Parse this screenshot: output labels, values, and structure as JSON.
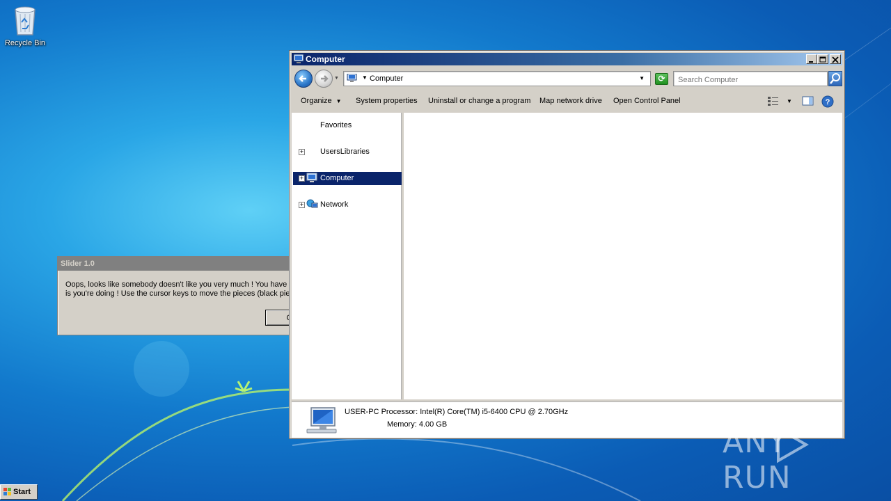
{
  "desktop": {
    "icons": [
      {
        "label": "Recycle Bin",
        "icon": "recycle-bin-icon"
      }
    ]
  },
  "slider_dialog": {
    "title": "Slider 1.0",
    "message_line1": "Oops, looks like somebody doesn't like you very much ! You have to",
    "message_line2": "is you're doing ! Use the cursor keys to move the pieces (black piec",
    "ok_label": "Ok"
  },
  "explorer": {
    "title": "Computer",
    "address": {
      "location": "Computer"
    },
    "search": {
      "placeholder": "Search Computer"
    },
    "toolbar": {
      "organize": "Organize",
      "system_properties": "System properties",
      "uninstall": "Uninstall or change a program",
      "map_drive": "Map network drive",
      "control_panel": "Open Control Panel"
    },
    "nav": {
      "items": [
        {
          "label": "Favorites",
          "icon": "star-icon",
          "expandable": false,
          "selected": false
        },
        {
          "label": "UsersLibraries",
          "icon": "library-icon",
          "expandable": true,
          "selected": false
        },
        {
          "label": "Computer",
          "icon": "computer-icon",
          "expandable": true,
          "selected": true
        },
        {
          "label": "Network",
          "icon": "network-icon",
          "expandable": true,
          "selected": false
        }
      ]
    },
    "details": {
      "name": "USER-PC",
      "processor_label": "Processor:",
      "processor": "Intel(R) Core(TM) i5-6400 CPU @ 2.70GHz",
      "memory_label": "Memory:",
      "memory": "4.00 GB"
    }
  },
  "taskbar": {
    "start_label": "Start"
  },
  "watermark": {
    "left": "ANY",
    "right": "RUN"
  },
  "colors": {
    "selection": "#0a246a",
    "dialog_title_bg": "#808080",
    "window_face": "#d4d0c8"
  }
}
